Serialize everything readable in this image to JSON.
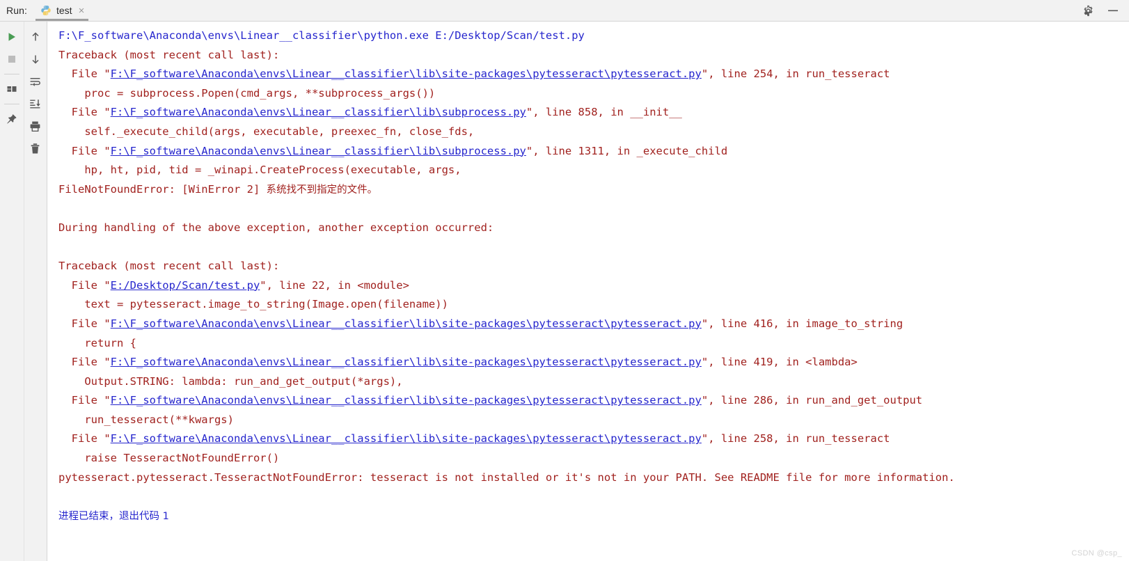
{
  "window": {
    "run_label": "Run:",
    "settings_icon": "gear-icon",
    "minimize_icon": "minimize-icon"
  },
  "tabs": [
    {
      "label": "test",
      "icon": "python-file-icon",
      "close": "×",
      "active": true
    }
  ],
  "left_toolbar": {
    "column_one": [
      {
        "name": "rerun-button",
        "icon": "play-icon",
        "label": "Rerun"
      },
      {
        "name": "stop-button",
        "icon": "stop-square-icon",
        "label": "Stop"
      },
      {
        "name": "layout-button",
        "icon": "layout-icon",
        "label": "Layout"
      },
      {
        "name": "pin-tab-button",
        "icon": "pin-icon",
        "label": "Pin Tab"
      }
    ],
    "column_two": [
      {
        "name": "up-the-stack-button",
        "icon": "arrow-up-icon",
        "label": "Up the Stack Trace"
      },
      {
        "name": "down-the-stack-button",
        "icon": "arrow-down-icon",
        "label": "Down the Stack Trace"
      },
      {
        "name": "soft-wrap-button",
        "icon": "soft-wrap-icon",
        "label": "Soft-Wrap"
      },
      {
        "name": "scroll-to-end-button",
        "icon": "scroll-to-end-icon",
        "label": "Scroll to End"
      },
      {
        "name": "print-button",
        "icon": "printer-icon",
        "label": "Print"
      },
      {
        "name": "clear-all-button",
        "icon": "trash-icon",
        "label": "Clear All"
      }
    ]
  },
  "console": {
    "command": "F:\\F_software\\Anaconda\\envs\\Linear__classifier\\python.exe E:/Desktop/Scan/test.py",
    "paths": {
      "pytesseract": "F:\\F_software\\Anaconda\\envs\\Linear__classifier\\lib\\site-packages\\pytesseract\\pytesseract.py",
      "subprocess": "F:\\F_software\\Anaconda\\envs\\Linear__classifier\\lib\\subprocess.py",
      "script": "E:/Desktop/Scan/test.py"
    },
    "lines": [
      {
        "id": "l1",
        "type": "command",
        "text": "F:\\F_software\\Anaconda\\envs\\Linear__classifier\\python.exe E:/Desktop/Scan/test.py"
      },
      {
        "id": "l2",
        "type": "error",
        "text": "Traceback (most recent call last):"
      },
      {
        "id": "l3",
        "type": "frame",
        "pre": "  File \"",
        "link": "F:\\F_software\\Anaconda\\envs\\Linear__classifier\\lib\\site-packages\\pytesseract\\pytesseract.py",
        "post": "\", line 254, in run_tesseract"
      },
      {
        "id": "l4",
        "type": "error",
        "text": "    proc = subprocess.Popen(cmd_args, **subprocess_args())"
      },
      {
        "id": "l5",
        "type": "frame",
        "pre": "  File \"",
        "link": "F:\\F_software\\Anaconda\\envs\\Linear__classifier\\lib\\subprocess.py",
        "post": "\", line 858, in __init__"
      },
      {
        "id": "l6",
        "type": "error",
        "text": "    self._execute_child(args, executable, preexec_fn, close_fds,"
      },
      {
        "id": "l7",
        "type": "frame",
        "pre": "  File \"",
        "link": "F:\\F_software\\Anaconda\\envs\\Linear__classifier\\lib\\subprocess.py",
        "post": "\", line 1311, in _execute_child"
      },
      {
        "id": "l8",
        "type": "error",
        "text": "    hp, ht, pid, tid = _winapi.CreateProcess(executable, args,"
      },
      {
        "id": "l9",
        "type": "error_cjk",
        "text": "FileNotFoundError: [WinError 2] ",
        "cjk": "系统找不到指定的文件。"
      },
      {
        "id": "l10",
        "type": "blank",
        "text": ""
      },
      {
        "id": "l11",
        "type": "error",
        "text": "During handling of the above exception, another exception occurred:"
      },
      {
        "id": "l12",
        "type": "blank",
        "text": ""
      },
      {
        "id": "l13",
        "type": "error",
        "text": "Traceback (most recent call last):"
      },
      {
        "id": "l14",
        "type": "frame",
        "pre": "  File \"",
        "link": "E:/Desktop/Scan/test.py",
        "post": "\", line 22, in <module>"
      },
      {
        "id": "l15",
        "type": "error",
        "text": "    text = pytesseract.image_to_string(Image.open(filename))"
      },
      {
        "id": "l16",
        "type": "frame",
        "pre": "  File \"",
        "link": "F:\\F_software\\Anaconda\\envs\\Linear__classifier\\lib\\site-packages\\pytesseract\\pytesseract.py",
        "post": "\", line 416, in image_to_string"
      },
      {
        "id": "l17",
        "type": "error",
        "text": "    return {"
      },
      {
        "id": "l18",
        "type": "frame",
        "pre": "  File \"",
        "link": "F:\\F_software\\Anaconda\\envs\\Linear__classifier\\lib\\site-packages\\pytesseract\\pytesseract.py",
        "post": "\", line 419, in <lambda>"
      },
      {
        "id": "l19",
        "type": "error",
        "text": "    Output.STRING: lambda: run_and_get_output(*args),"
      },
      {
        "id": "l20",
        "type": "frame",
        "pre": "  File \"",
        "link": "F:\\F_software\\Anaconda\\envs\\Linear__classifier\\lib\\site-packages\\pytesseract\\pytesseract.py",
        "post": "\", line 286, in run_and_get_output"
      },
      {
        "id": "l21",
        "type": "error",
        "text": "    run_tesseract(**kwargs)"
      },
      {
        "id": "l22",
        "type": "frame",
        "pre": "  File \"",
        "link": "F:\\F_software\\Anaconda\\envs\\Linear__classifier\\lib\\site-packages\\pytesseract\\pytesseract.py",
        "post": "\", line 258, in run_tesseract"
      },
      {
        "id": "l23",
        "type": "error",
        "text": "    raise TesseractNotFoundError()"
      },
      {
        "id": "l24",
        "type": "error",
        "text": "pytesseract.pytesseract.TesseractNotFoundError: tesseract is not installed or it's not in your PATH. See README file for more information."
      },
      {
        "id": "l25",
        "type": "blank",
        "text": ""
      },
      {
        "id": "l26",
        "type": "exit",
        "text": "进程已结束，退出代码 1"
      }
    ]
  },
  "watermark": "CSDN @csp_",
  "colors": {
    "command_blue": "#2626cd",
    "error_red": "#a1221f",
    "link_blue": "#2626cd",
    "panel_gray": "#f2f2f2",
    "console_bg": "#ffffff",
    "play_green": "#499c54"
  }
}
